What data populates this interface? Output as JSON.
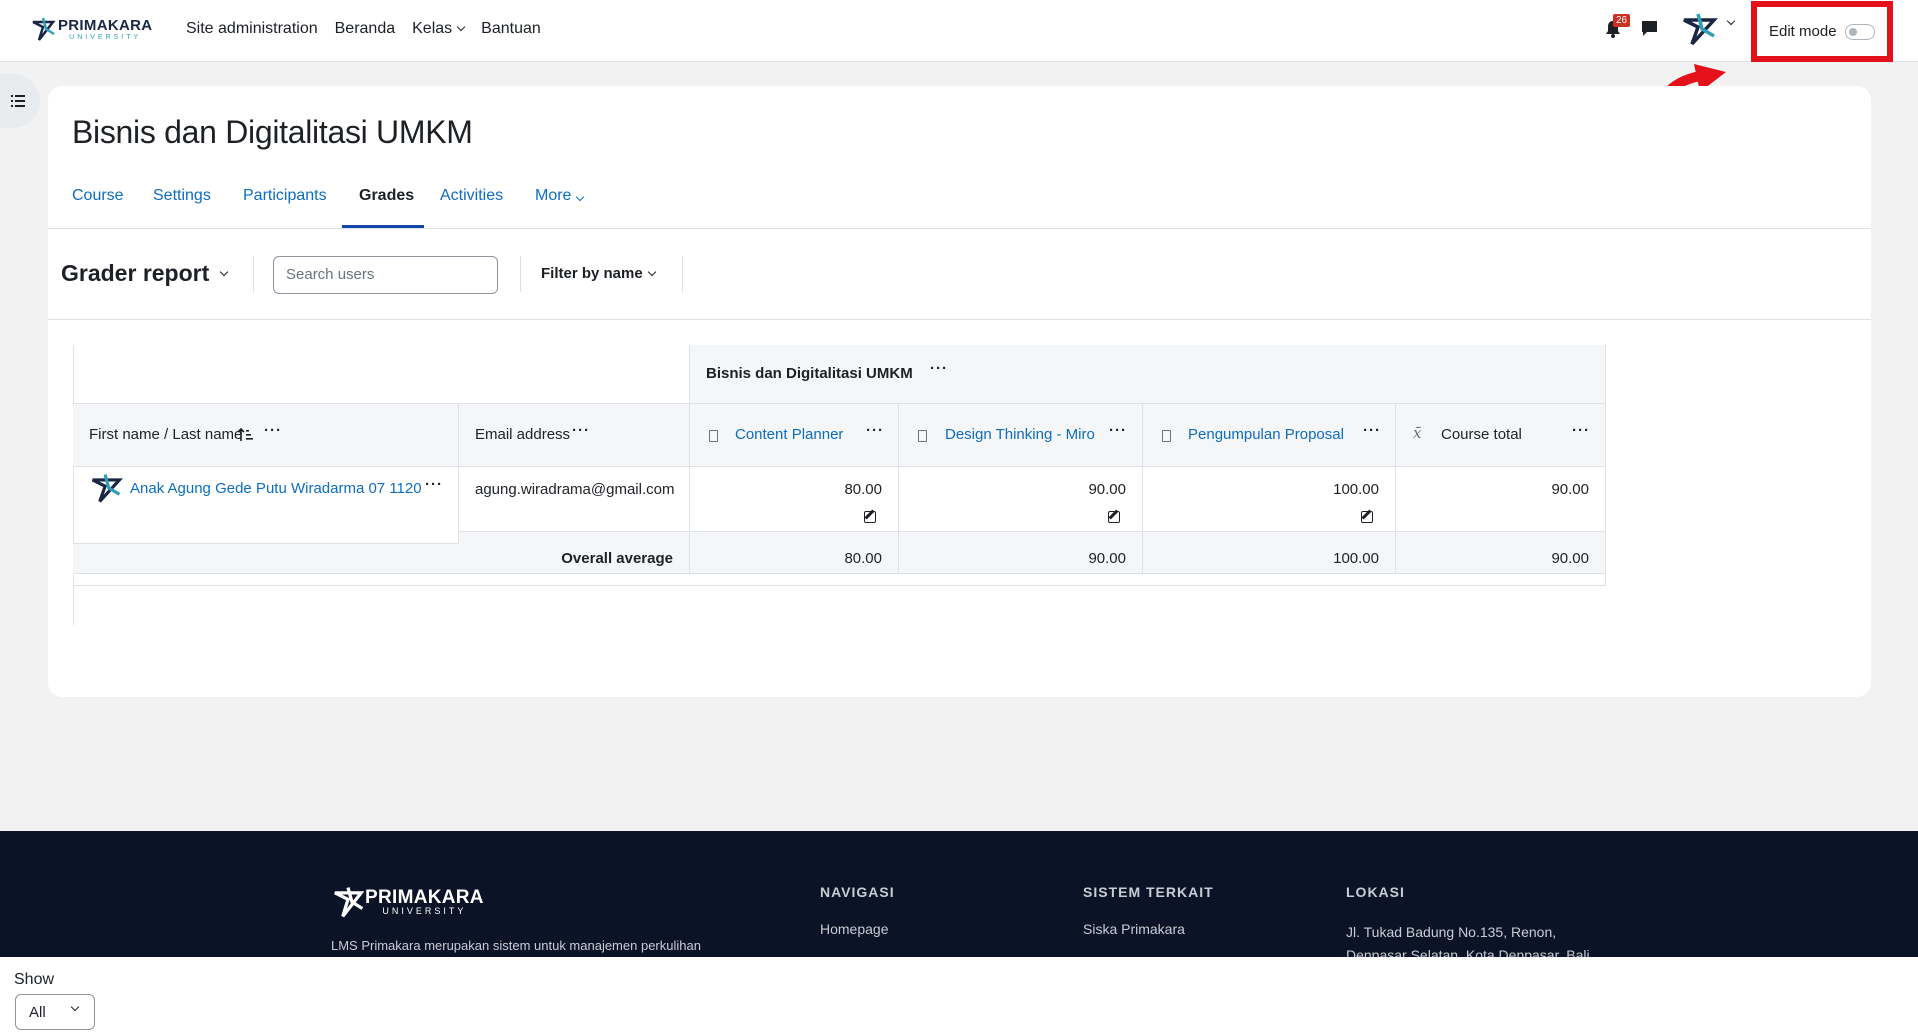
{
  "topnav": {
    "logo_big": "PRIMAKARA",
    "logo_small": "UNIVERSITY",
    "links": [
      "Site administration",
      "Beranda",
      "Kelas",
      "Bantuan"
    ],
    "notification_count": "26",
    "edit_mode_label": "Edit mode"
  },
  "course": {
    "title": "Bisnis dan Digitalitasi UMKM",
    "tabs": [
      "Course",
      "Settings",
      "Participants",
      "Grades",
      "Activities",
      "More"
    ],
    "active_tab": "Grades"
  },
  "report": {
    "title": "Grader report",
    "search_placeholder": "Search users",
    "filter_label": "Filter by name"
  },
  "grader_table": {
    "category_header": "Bisnis dan Digitalitasi UMKM",
    "name_header": "First name / Last name",
    "email_header": "Email address",
    "items": [
      "Content Planner",
      "Design Thinking - Miro",
      "Pengumpulan Proposal"
    ],
    "total_header": "Course total",
    "rows": [
      {
        "name": "Anak Agung Gede Putu Wiradarma 07 1120",
        "email": "agung.wiradrama@gmail.com",
        "grades": [
          "80.00",
          "90.00",
          "100.00"
        ],
        "total": "90.00"
      }
    ],
    "average_label": "Overall average",
    "averages": [
      "80.00",
      "90.00",
      "100.00"
    ],
    "average_total": "90.00"
  },
  "footer": {
    "logo_big": "PRIMAKARA",
    "logo_small": "UNIVERSITY",
    "description": "LMS Primakara merupakan sistem untuk manajemen perkulihan",
    "nav_heading": "NAVIGASI",
    "nav_link": "Homepage",
    "related_heading": "SISTEM TERKAIT",
    "related_link": "Siska Primakara",
    "location_heading": "LOKASI",
    "address_line1": "Jl. Tukad Badung No.135, Renon,",
    "address_line2": "Denpasar Selatan, Kota Denpasar, Bali"
  },
  "pagination": {
    "show_label": "Show",
    "per_page_value": "All"
  },
  "colors": {
    "link": "#0f6cbf",
    "highlight_box": "#e4111a",
    "footer_bg": "#0b1426",
    "badge": "#ca3120"
  }
}
